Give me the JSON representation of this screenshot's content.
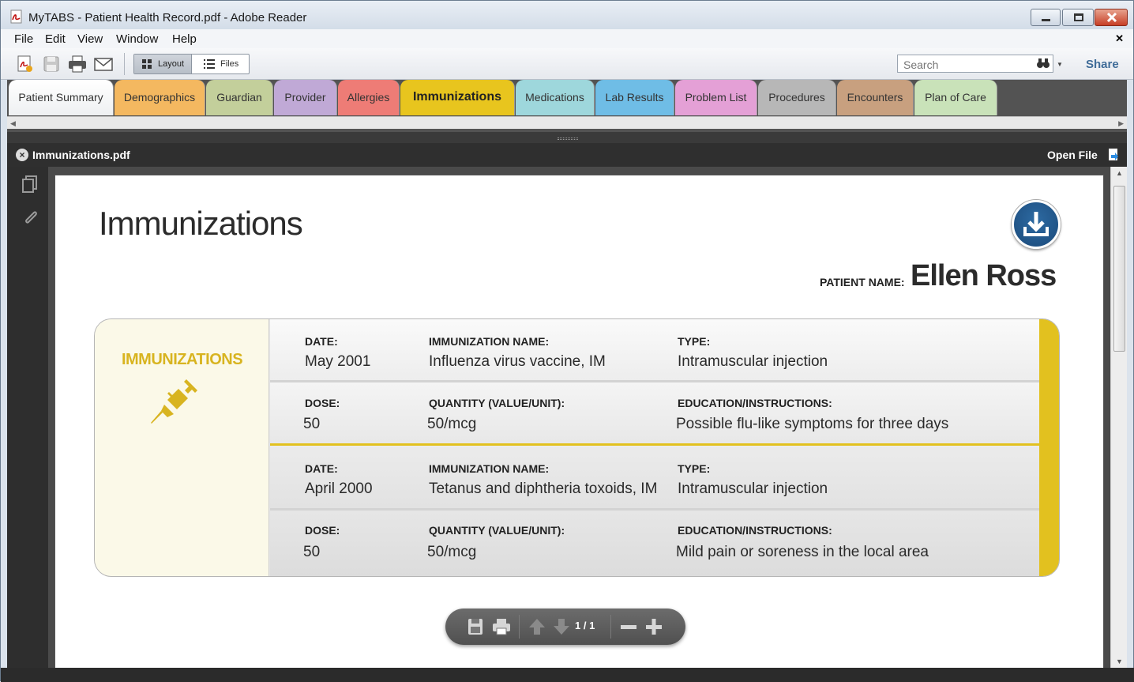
{
  "window": {
    "title": "MyTABS - Patient Health Record.pdf - Adobe Reader"
  },
  "menu": [
    "File",
    "Edit",
    "View",
    "Window",
    "Help"
  ],
  "toolbar": {
    "layout_label": "Layout",
    "files_label": "Files",
    "search_placeholder": "Search",
    "share_label": "Share"
  },
  "tabs": [
    {
      "label": "Patient Summary",
      "color": "#f2f2f2"
    },
    {
      "label": "Demographics",
      "color": "#f4b860"
    },
    {
      "label": "Guardian",
      "color": "#c3cf9b"
    },
    {
      "label": "Provider",
      "color": "#c0a9d6"
    },
    {
      "label": "Allergies",
      "color": "#ee7c76"
    },
    {
      "label": "Immunizations",
      "color": "#e8c51e"
    },
    {
      "label": "Medications",
      "color": "#9ed7dc"
    },
    {
      "label": "Lab Results",
      "color": "#6fbde6"
    },
    {
      "label": "Problem List",
      "color": "#e4a0d6"
    },
    {
      "label": "Procedures",
      "color": "#b7b7b7"
    },
    {
      "label": "Encounters",
      "color": "#c8a07f"
    },
    {
      "label": "Plan of Care",
      "color": "#c9e2b9"
    }
  ],
  "document": {
    "name": "Immunizations.pdf",
    "open_file_label": "Open File"
  },
  "page": {
    "title": "Immunizations",
    "patient_label": "PATIENT NAME:",
    "patient_name": "Ellen Ross",
    "section_title": "IMMUNIZATIONS",
    "labels": {
      "date": "DATE:",
      "immunization_name": "IMMUNIZATION NAME:",
      "type": "TYPE:",
      "dose": "DOSE:",
      "quantity": "QUANTITY (VALUE/UNIT):",
      "education": "EDUCATION/INSTRUCTIONS:"
    },
    "records": [
      {
        "date": "May 2001",
        "name": "Influenza virus vaccine, IM",
        "type": "Intramuscular injection",
        "dose": "50",
        "quantity": "50/mcg",
        "education": "Possible flu-like symptoms for three days"
      },
      {
        "date": "April 2000",
        "name": "Tetanus and diphtheria toxoids, IM",
        "type": "Intramuscular injection",
        "dose": "50",
        "quantity": "50/mcg",
        "education": "Mild pain or soreness in the local area"
      }
    ]
  },
  "pdf_toolbar": {
    "page_indicator": "1 / 1"
  },
  "colors": {
    "accent": "#e2c11f",
    "share": "#3f6c98",
    "download": "#1f5a8f"
  }
}
